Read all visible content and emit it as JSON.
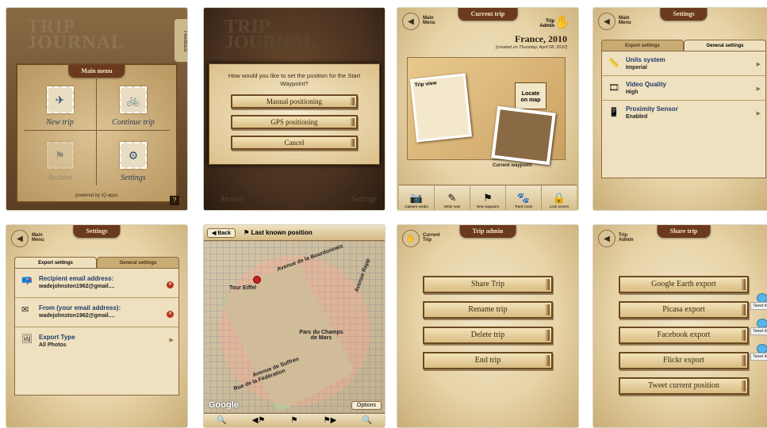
{
  "s1": {
    "logo_line1": "TRIP",
    "logo_line2": "JOURNAL",
    "feedback": "Feedback",
    "tab_title": "Main menu",
    "items": [
      {
        "label": "New trip"
      },
      {
        "label": "Continue trip"
      },
      {
        "label": "Archive"
      },
      {
        "label": "Settings"
      }
    ],
    "powered": "powered by iQ-apps",
    "help": "?"
  },
  "s2": {
    "question": "How would you like to set the position for the Start Waypoint?",
    "buttons": [
      "Manual positioning",
      "GPS positioning",
      "Cancel"
    ],
    "bottom_left": "Archive",
    "bottom_right": "Settings"
  },
  "s3": {
    "tab_title": "Current trip",
    "back_label_1": "Main",
    "back_label_2": "Menu",
    "admin_label_1": "Trip",
    "admin_label_2": "Admin",
    "trip_name": "France, 2010",
    "created": "[created on Thursday, April 08, 2010]",
    "trip_view": "Trip view",
    "locate_1": "Locate",
    "locate_2": "on map",
    "current_waypoint": "Current waypoint",
    "toolbar": [
      "Capture media",
      "Write note",
      "New waypoint",
      "Track route",
      "Lock screen"
    ]
  },
  "s4": {
    "tab_title": "Settings",
    "back_label_1": "Main",
    "back_label_2": "Menu",
    "tabs": [
      "Export settings",
      "General settings"
    ],
    "rows": [
      {
        "title": "Units system",
        "value": "Imperial"
      },
      {
        "title": "Video Quality",
        "value": "High"
      },
      {
        "title": "Proximity Sensor",
        "value": "Enabled"
      }
    ]
  },
  "s5": {
    "tab_title": "Settings",
    "back_label_1": "Main",
    "back_label_2": "Menu",
    "tabs": [
      "Export settings",
      "General settings"
    ],
    "rows": [
      {
        "title": "Recipient email address:",
        "value": "wadejohnston1962@gmail...."
      },
      {
        "title": "From (your email address):",
        "value": "wadejohnston1962@gmail...."
      },
      {
        "title": "Export Type",
        "value": "All Photos"
      }
    ]
  },
  "s6": {
    "back": "Back",
    "title": "Last known position",
    "labels": [
      "Tour Eiffel",
      "Parc du Champs de Mars",
      "Avenue Rapp",
      "Rue de la Fédération",
      "Avenue de Suffren",
      "Avenue de la Bourdonnais"
    ],
    "google": "Google",
    "options": "Options"
  },
  "s7": {
    "tab_title": "Trip admin",
    "back_label_1": "Current",
    "back_label_2": "Trip",
    "buttons": [
      "Share Trip",
      "Rename trip",
      "Delete trip",
      "End trip"
    ]
  },
  "s8": {
    "tab_title": "Share trip",
    "back_label_1": "Trip",
    "back_label_2": "Admin",
    "buttons": [
      "Google Earth export",
      "Picasa export",
      "Facebook export",
      "Flickr export",
      "Tweet current position"
    ],
    "tweet_it": "Tweet it!"
  }
}
